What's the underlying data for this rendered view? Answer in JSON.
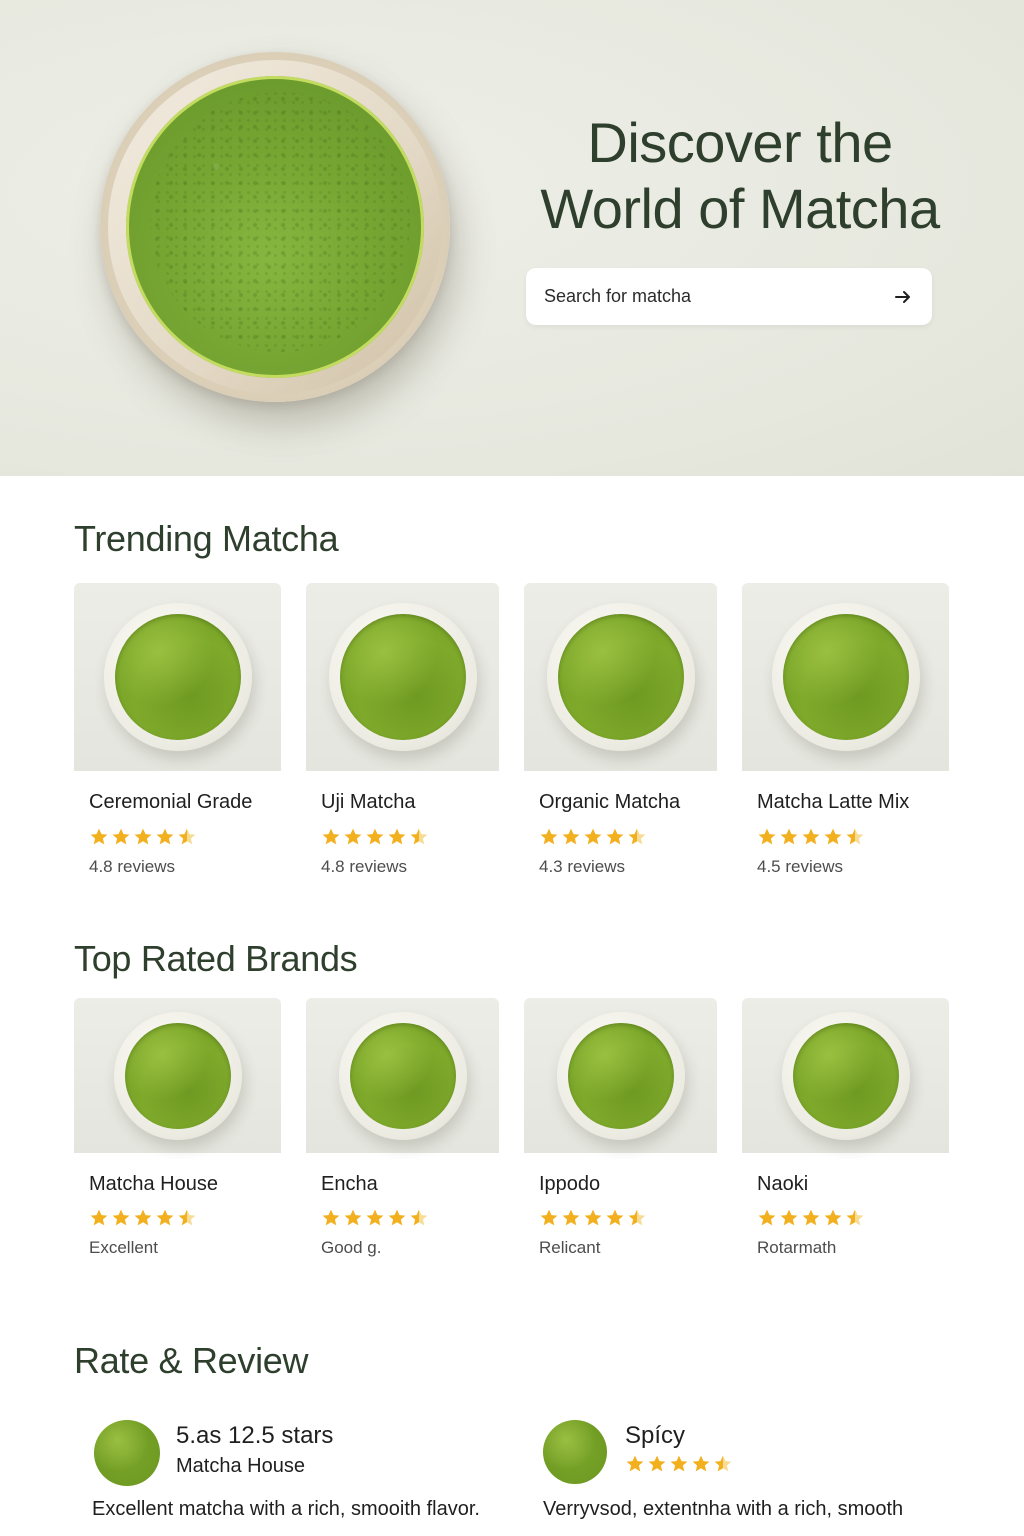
{
  "hero": {
    "title_line1": "Discover the",
    "title_line2": "World of Matcha",
    "search_placeholder": "Search for matcha"
  },
  "trending": {
    "title": "Trending Matcha",
    "items": [
      {
        "name": "Ceremonial Grade",
        "rating": 4.5,
        "meta": "4.8 reviews"
      },
      {
        "name": "Uji Matcha",
        "rating": 4.5,
        "meta": "4.8 reviews"
      },
      {
        "name": "Organic Matcha",
        "rating": 4.5,
        "meta": "4.3 reviews"
      },
      {
        "name": "Matcha Latte Mix",
        "rating": 4.5,
        "meta": "4.5 reviews"
      }
    ]
  },
  "brands": {
    "title": "Top Rated Brands",
    "items": [
      {
        "name": "Matcha House",
        "rating": 4.5,
        "meta": "Excellent"
      },
      {
        "name": "Encha",
        "rating": 4.5,
        "meta": "Good g."
      },
      {
        "name": "Ippodo",
        "rating": 4.5,
        "meta": "Relicant"
      },
      {
        "name": "Naoki",
        "rating": 4.5,
        "meta": "Rotarmath"
      }
    ]
  },
  "reviews": {
    "title": "Rate & Review",
    "items": [
      {
        "line1": "5.as 12.5 stars",
        "line2": "Matcha House",
        "text": "Excellent matcha with a rich, smooith flavor."
      },
      {
        "line1": "Spícy",
        "rating": 4.5,
        "text": "Verryvsod, extentnha with a rich, smooth"
      }
    ]
  },
  "colors": {
    "heading": "#2e3f2d",
    "star": "#f2b01e",
    "hero_bg": "#e6e8de"
  },
  "icons": {
    "search_submit": "arrow-right-icon",
    "rating": "star-icon"
  }
}
